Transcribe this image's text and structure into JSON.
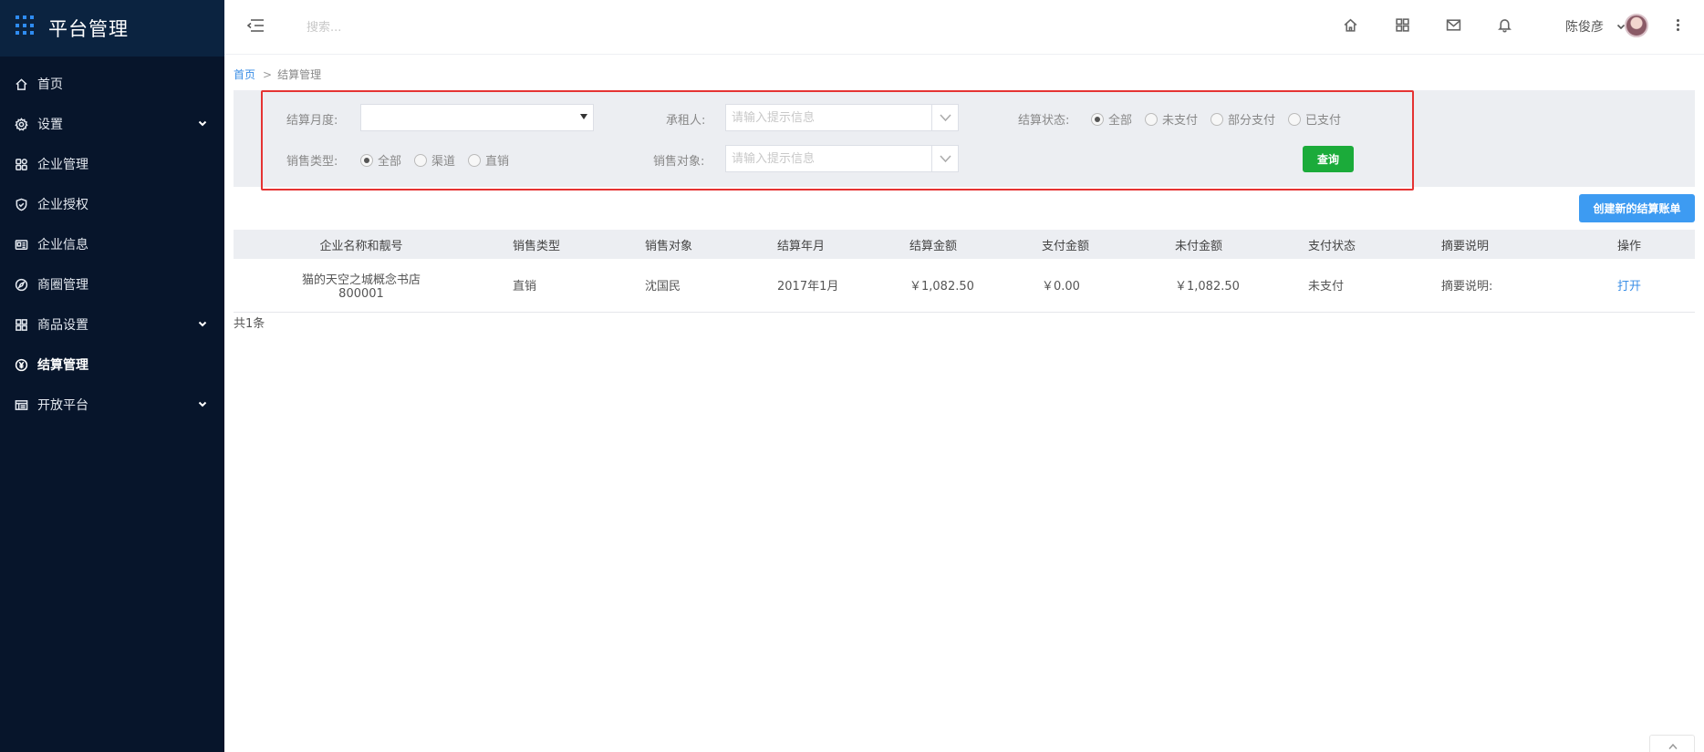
{
  "app": {
    "title": "平台管理"
  },
  "sidebar": {
    "items": [
      {
        "label": "首页",
        "icon": "home-icon",
        "expandable": false,
        "active": false
      },
      {
        "label": "设置",
        "icon": "gear-icon",
        "expandable": true,
        "active": false
      },
      {
        "label": "企业管理",
        "icon": "enterprise-icon",
        "expandable": false,
        "active": false
      },
      {
        "label": "企业授权",
        "icon": "shield-icon",
        "expandable": false,
        "active": false
      },
      {
        "label": "企业信息",
        "icon": "id-card-icon",
        "expandable": false,
        "active": false
      },
      {
        "label": "商圈管理",
        "icon": "compass-icon",
        "expandable": false,
        "active": false
      },
      {
        "label": "商品设置",
        "icon": "grid-icon",
        "expandable": true,
        "active": false
      },
      {
        "label": "结算管理",
        "icon": "yuan-icon",
        "expandable": false,
        "active": true
      },
      {
        "label": "开放平台",
        "icon": "list-icon",
        "expandable": true,
        "active": false
      }
    ]
  },
  "header": {
    "search_placeholder": "搜索...",
    "icons": [
      "home-icon",
      "apps-icon",
      "mail-icon",
      "bell-icon"
    ],
    "user_name": "陈俊彦"
  },
  "breadcrumb": {
    "home": "首页",
    "separator": ">",
    "current": "结算管理"
  },
  "filters": {
    "settle_month_label": "结算月度:",
    "settle_month_value": "",
    "tenant_label": "承租人:",
    "tenant_placeholder": "请输入提示信息",
    "status_label": "结算状态:",
    "status_options": [
      "全部",
      "未支付",
      "部分支付",
      "已支付"
    ],
    "status_selected": 0,
    "sale_type_label": "销售类型:",
    "sale_type_options": [
      "全部",
      "渠道",
      "直销"
    ],
    "sale_type_selected": 0,
    "sale_target_label": "销售对象:",
    "sale_target_placeholder": "请输入提示信息",
    "query_label": "查询"
  },
  "create_button_label": "创建新的结算账单",
  "table": {
    "columns": [
      "企业名称和靓号",
      "销售类型",
      "销售对象",
      "结算年月",
      "结算金额",
      "支付金额",
      "未付金额",
      "支付状态",
      "摘要说明",
      "操作"
    ],
    "rows": [
      {
        "company_name": "猫的天空之城概念书店",
        "company_number": "800001",
        "sale_type": "直销",
        "sale_target": "沈国民",
        "settle_month": "2017年1月",
        "settle_amount": "￥1,082.50",
        "paid_amount": "￥0.00",
        "unpaid_amount": "￥1,082.50",
        "pay_status": "未支付",
        "summary": "摘要说明:",
        "action": "打开"
      }
    ],
    "total_text": "共1条"
  },
  "colors": {
    "sidebar_bg": "#07152b",
    "brand_bg": "#0b2340",
    "accent_blue": "#3d9bf2",
    "query_green": "#1bab3a",
    "highlight_red": "#e53333"
  }
}
